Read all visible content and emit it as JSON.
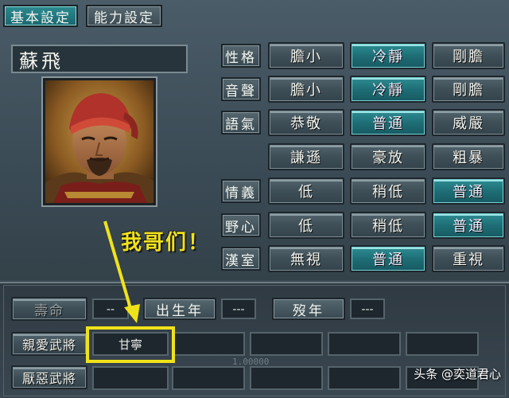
{
  "tabs": {
    "basic": "基本設定",
    "ability": "能力設定"
  },
  "officer": {
    "name": "蘇飛"
  },
  "traits": {
    "personality": {
      "label": "性格",
      "options": [
        "膽小",
        "冷靜",
        "剛膽"
      ],
      "selected": 1
    },
    "voice": {
      "label": "音聲",
      "options": [
        "膽小",
        "冷靜",
        "剛膽"
      ],
      "selected": 1
    },
    "tone": {
      "label": "語氣",
      "options": [
        "恭敬",
        "普通",
        "威嚴"
      ],
      "selected": 1
    },
    "tone2": {
      "label": "",
      "options": [
        "謙遜",
        "豪放",
        "粗暴"
      ],
      "selected": -1
    },
    "loyalty": {
      "label": "情義",
      "options": [
        "低",
        "稍低",
        "普通"
      ],
      "selected": 2
    },
    "ambition": {
      "label": "野心",
      "options": [
        "低",
        "稍低",
        "普通"
      ],
      "selected": 2
    },
    "han": {
      "label": "漢室",
      "options": [
        "無視",
        "普通",
        "重視"
      ],
      "selected": 1
    }
  },
  "lifespan": {
    "life_label": "壽命",
    "life_value": "--",
    "birth_label": "出生年",
    "birth_value": "---",
    "death_label": "歿年",
    "death_value": "---"
  },
  "relations": {
    "liked_label": "親愛武將",
    "liked": [
      "甘寧",
      "",
      "",
      "",
      ""
    ],
    "disliked_label": "厭惡武將",
    "disliked": [
      "",
      "",
      "",
      "",
      ""
    ]
  },
  "faint_number": "1.00000",
  "annotation": {
    "callout": "我哥们！",
    "color": "#f0e21a"
  },
  "watermark": "头条 @奕道君心"
}
